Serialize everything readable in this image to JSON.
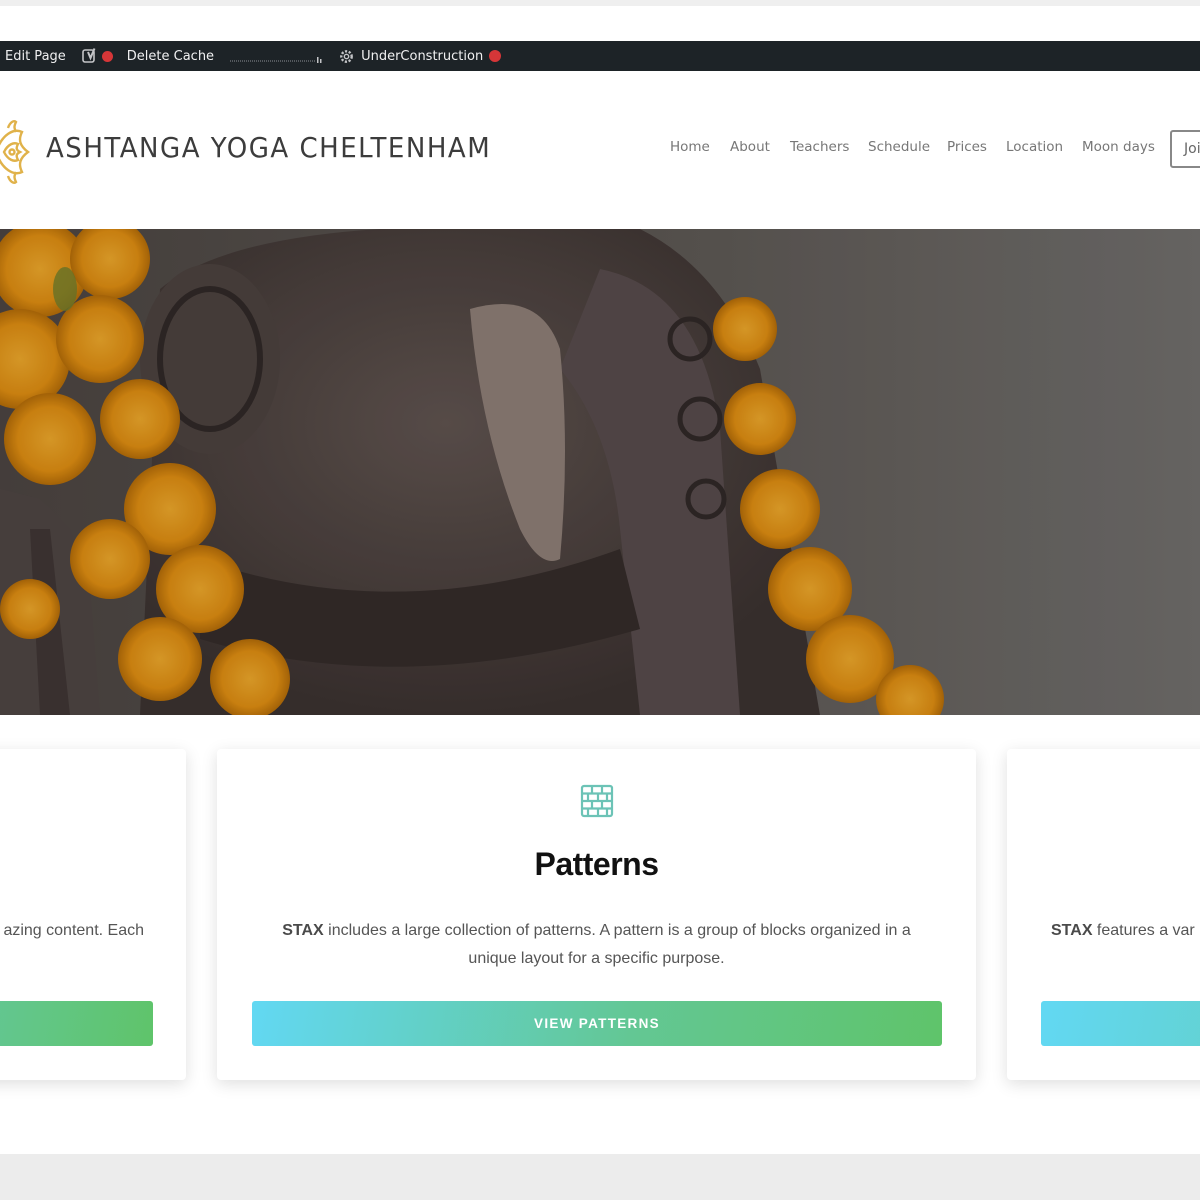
{
  "admin_bar": {
    "edit_page": "Edit Page",
    "delete_cache": "Delete Cache",
    "under_construction": "UnderConstruction",
    "status_color": "#d63638"
  },
  "header": {
    "site_title": "ASHTANGA YOGA CHELTENHAM",
    "logo_color": "#e0b24a",
    "nav": [
      "Home",
      "About",
      "Teachers",
      "Schedule",
      "Prices",
      "Location",
      "Moon days"
    ],
    "cta_label": "Joi"
  },
  "cards": {
    "left": {
      "text": "azing content. Each"
    },
    "center": {
      "icon": "brick-wall-icon",
      "heading": "Patterns",
      "text_brand": "STAX",
      "text_line1": " includes a large collection of patterns. A pattern is a group of blocks organized in a",
      "text_line2": "unique layout for a specific purpose.",
      "button": "VIEW PATTERNS"
    },
    "right": {
      "text_brand": "STAX",
      "text": " features a var"
    }
  },
  "colors": {
    "accent_gradient_start": "#62d8f3",
    "accent_gradient_end": "#5fc46a",
    "icon_teal": "#6cc3b6"
  }
}
